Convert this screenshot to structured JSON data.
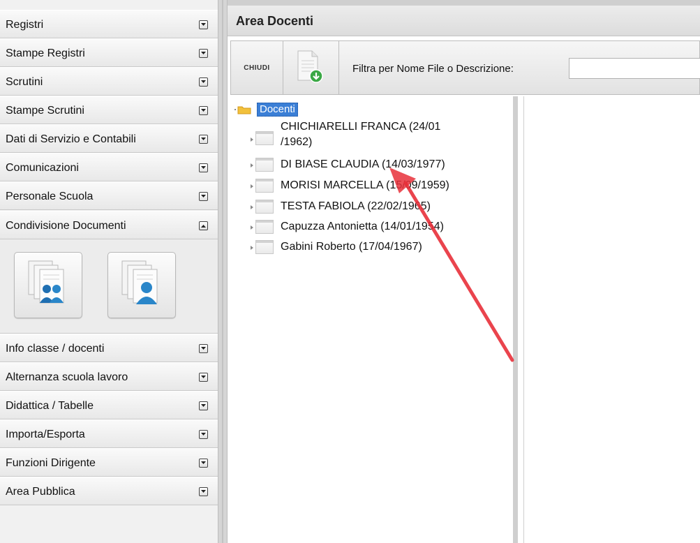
{
  "sidebar": {
    "items": [
      {
        "label": "Registri",
        "state": "collapsed"
      },
      {
        "label": "Stampe Registri",
        "state": "collapsed"
      },
      {
        "label": "Scrutini",
        "state": "collapsed"
      },
      {
        "label": "Stampe Scrutini",
        "state": "collapsed"
      },
      {
        "label": "Dati di Servizio e Contabili",
        "state": "collapsed"
      },
      {
        "label": "Comunicazioni",
        "state": "collapsed"
      },
      {
        "label": "Personale Scuola",
        "state": "collapsed"
      },
      {
        "label": "Condivisione Documenti",
        "state": "expanded"
      },
      {
        "label": "Info classe / docenti",
        "state": "collapsed"
      },
      {
        "label": "Alternanza scuola lavoro",
        "state": "collapsed"
      },
      {
        "label": "Didattica / Tabelle",
        "state": "collapsed"
      },
      {
        "label": "Importa/Esporta",
        "state": "collapsed"
      },
      {
        "label": "Funzioni Dirigente",
        "state": "collapsed"
      },
      {
        "label": "Area Pubblica",
        "state": "collapsed"
      }
    ],
    "panel_icons": [
      "group-documents-icon",
      "single-user-documents-icon"
    ]
  },
  "main": {
    "title": "Area Docenti",
    "toolbar": {
      "close_label": "CHIUDI",
      "upload_icon": "document-upload-icon",
      "filter_label": "Filtra per Nome File o Descrizione:",
      "filter_value": ""
    },
    "tree": {
      "root_label": "Docenti",
      "nodes": [
        {
          "line1": "CHICHIARELLI FRANCA (24/01",
          "line2": "/1962)"
        },
        {
          "line1": "DI BIASE CLAUDIA (14/03/1977)",
          "line2": ""
        },
        {
          "line1": "MORISI MARCELLA (15/09/1959)",
          "line2": ""
        },
        {
          "line1": "TESTA FABIOLA (22/02/1965)",
          "line2": ""
        },
        {
          "line1": "Capuzza Antonietta (14/01/1954)",
          "line2": ""
        },
        {
          "line1": "Gabini Roberto (17/04/1967)",
          "line2": ""
        }
      ]
    }
  },
  "colors": {
    "selection": "#3b7fd6",
    "annotation": "#e8303a",
    "folder": "#f2c13c",
    "upload_badge": "#3aa845"
  }
}
